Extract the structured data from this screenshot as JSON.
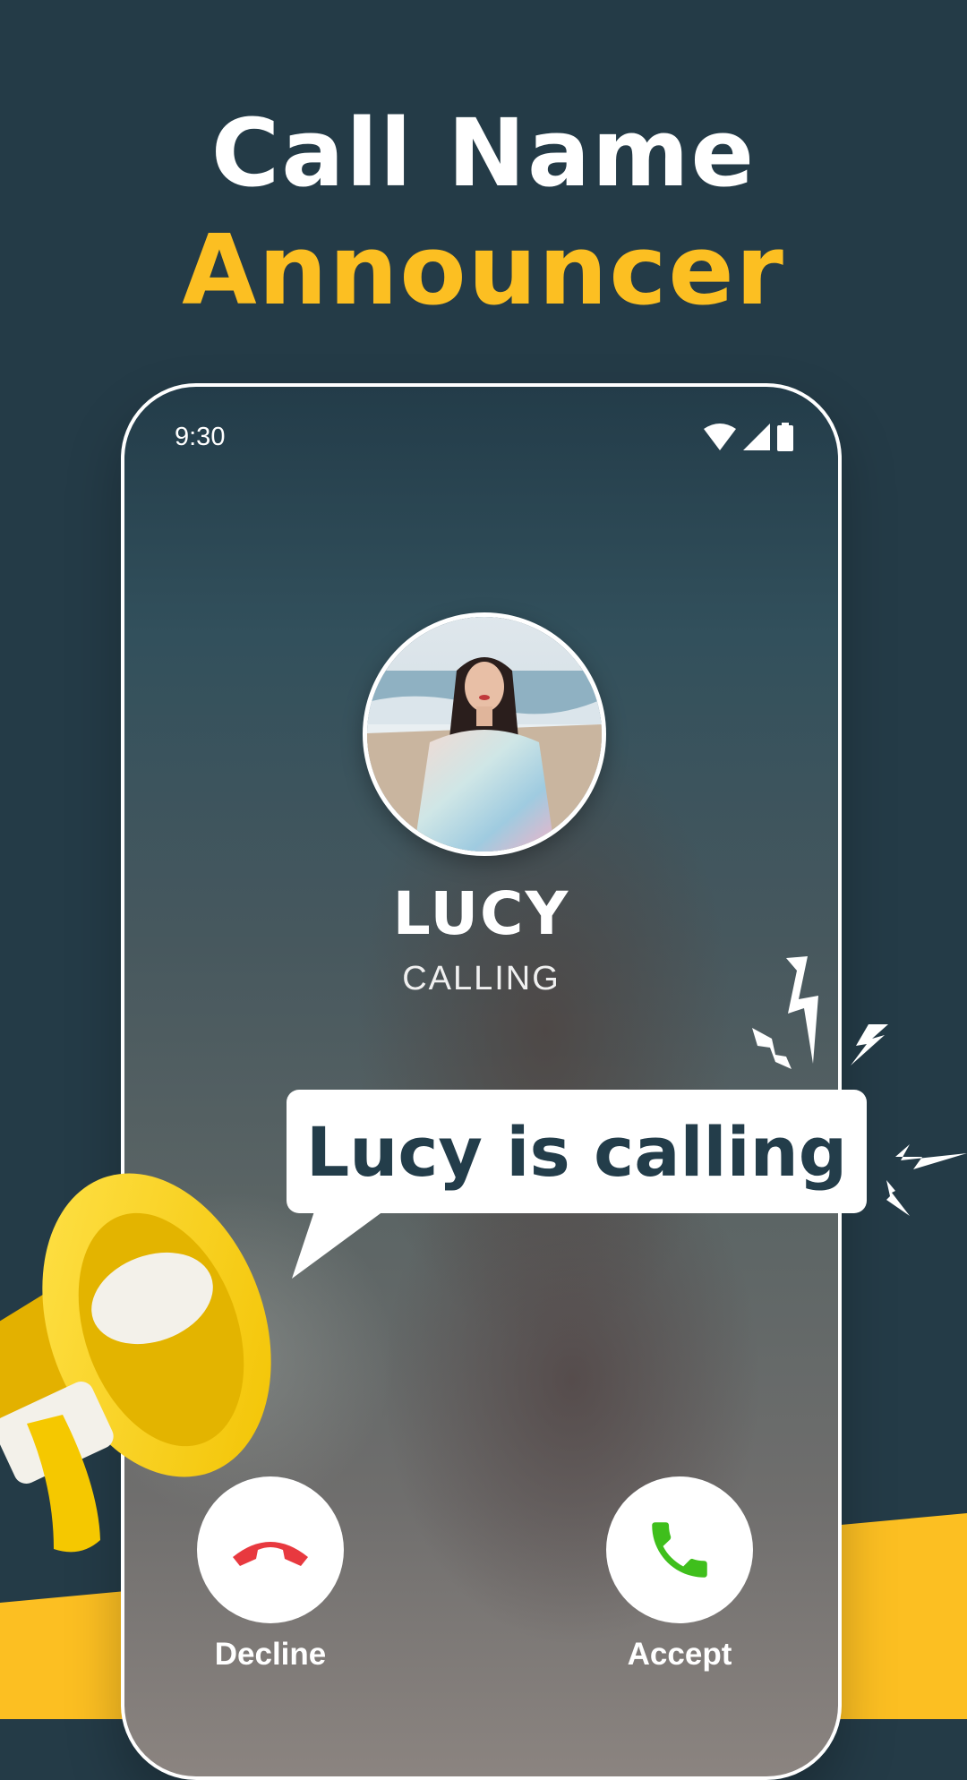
{
  "headline": {
    "line1": "Call Name",
    "line2": "Announcer"
  },
  "colors": {
    "background": "#243b47",
    "accent_yellow": "#fcbf22",
    "decline_red": "#e8393f",
    "accept_green": "#3fbf1c",
    "bubble_text": "#233d4a"
  },
  "phone": {
    "status_bar": {
      "time": "9:30",
      "icons": [
        "wifi-icon",
        "signal-icon",
        "battery-icon"
      ]
    },
    "caller": {
      "name": "LUCY",
      "status": "CALLING"
    },
    "actions": {
      "decline_label": "Decline",
      "accept_label": "Accept"
    }
  },
  "announcement": {
    "text": "Lucy is calling"
  }
}
